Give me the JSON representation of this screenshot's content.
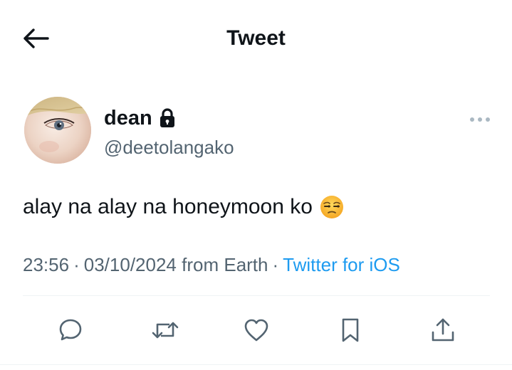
{
  "header": {
    "title": "Tweet",
    "back_icon": "arrow-left-icon"
  },
  "tweet": {
    "author": {
      "display_name": "dean",
      "handle": "@deetolangako",
      "protected_icon": "lock-icon",
      "avatar": "avatar-photo"
    },
    "text": "alay na alay na honeymoon ko",
    "emoji": "unamused-face-emoji",
    "time": "23:56",
    "date": "03/10/2024",
    "location": "from Earth",
    "source": "Twitter for iOS",
    "separator": "·"
  },
  "actions": [
    {
      "icon": "reply-icon"
    },
    {
      "icon": "retweet-icon"
    },
    {
      "icon": "like-icon"
    },
    {
      "icon": "bookmark-icon"
    },
    {
      "icon": "share-icon"
    }
  ],
  "colors": {
    "text": "#0f1419",
    "secondary": "#536471",
    "link": "#1d9bf0",
    "divider": "#eff3f4"
  }
}
